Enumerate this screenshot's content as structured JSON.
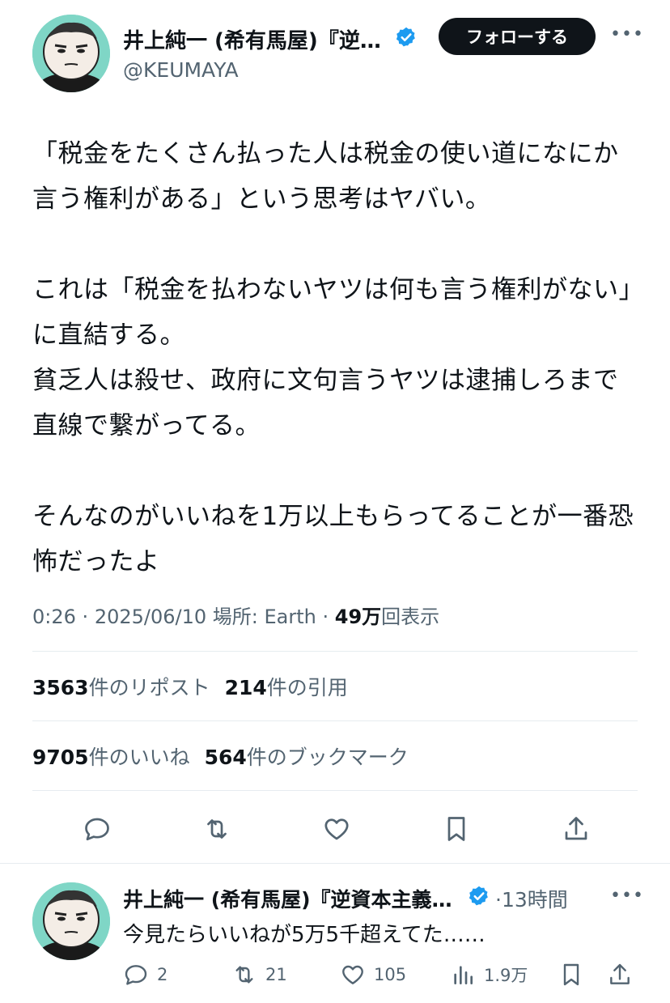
{
  "tweet": {
    "author_name": "井上純一 (希有馬屋)『逆資本主義』発売中",
    "handle": "@KEUMAYA",
    "follow_label": "フォローする",
    "more_icon": "more-dots-icon",
    "text": "「税金をたくさん払った人は税金の使い道になにか言う権利がある」という思考はヤバい。\n\nこれは「税金を払わないヤツは何も言う権利がない」に直結する。\n貧乏人は殺せ、政府に文句言うヤツは逮捕しろまで直線で繋がってる。\n\nそんなのがいいねを1万以上もらってることが一番恐怖だったよ",
    "time": "0:26",
    "date": "2025/06/10",
    "location": "場所: Earth",
    "views_count": "49万",
    "views_label": "回表示",
    "reposts_count": "3563",
    "reposts_label": "件のリポスト",
    "quotes_count": "214",
    "quotes_label": "件の引用",
    "likes_count": "9705",
    "likes_label": "件のいいね",
    "bookmarks_count": "564",
    "bookmarks_label": "件のブックマーク"
  },
  "reply": {
    "author_name": "井上純一 (希有馬屋)『逆資本主義』発売中",
    "time_ago": "13時間",
    "text": "今見たらいいねが5万5千超えてた……",
    "replies": "2",
    "reposts": "21",
    "likes": "105",
    "views": "1.9万"
  },
  "colors": {
    "text": "#0f1419",
    "secondary": "#536471",
    "verified": "#1d9bf0",
    "divider": "#e6ecf0"
  }
}
